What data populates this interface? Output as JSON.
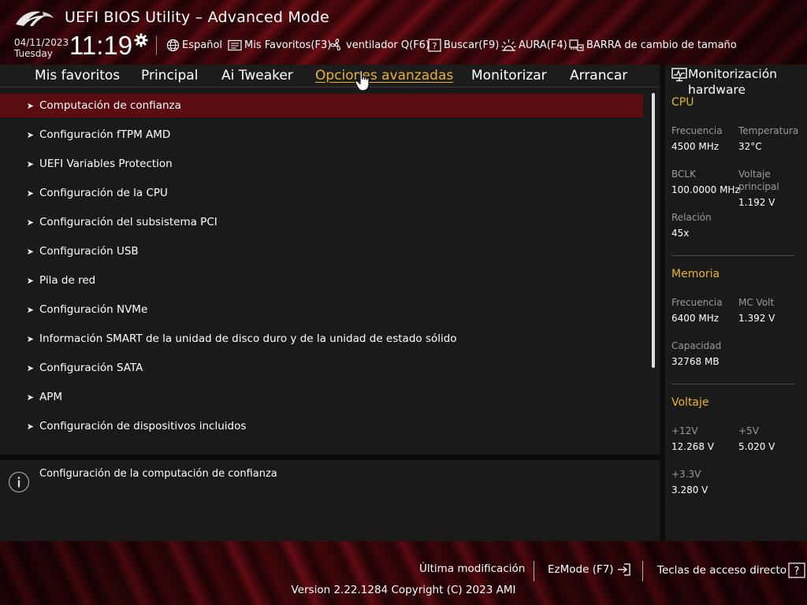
{
  "header": {
    "title": "UEFI BIOS Utility – Advanced Mode",
    "date": "04/11/2023",
    "day": "Tuesday",
    "time": "11:19",
    "toolbar": {
      "language": "Español",
      "favorites": "Mis Favoritos(F3)",
      "qfan": "ventilador Q(F6)",
      "search": "Buscar(F9)",
      "aura": "AURA(F4)",
      "resize_bar": "BARRA de cambio de tamaño"
    }
  },
  "nav": {
    "tabs": [
      {
        "label": "Mis favoritos"
      },
      {
        "label": "Principal"
      },
      {
        "label": "Ai Tweaker"
      },
      {
        "label": "Opciones avanzadas",
        "active": true
      },
      {
        "label": "Monitorizar"
      },
      {
        "label": "Arrancar"
      }
    ]
  },
  "menu": {
    "items": [
      {
        "label": "Computación de confianza",
        "selected": true
      },
      {
        "label": "Configuración fTPM AMD"
      },
      {
        "label": "UEFI Variables Protection"
      },
      {
        "label": "Configuración de la CPU"
      },
      {
        "label": "Configuración del subsistema PCI"
      },
      {
        "label": "Configuración USB"
      },
      {
        "label": "Pila de red"
      },
      {
        "label": "Configuración NVMe"
      },
      {
        "label": "Información SMART de la unidad de disco duro y de la unidad de estado sólido"
      },
      {
        "label": "Configuración SATA"
      },
      {
        "label": "APM"
      },
      {
        "label": "Configuración de dispositivos incluidos"
      }
    ],
    "arrow_glyph": "➤"
  },
  "help": {
    "text": "Configuración de la computación de confianza"
  },
  "hw_monitor": {
    "title": "Monitorización hardware",
    "cpu": {
      "heading": "CPU",
      "freq_label": "Frecuencia",
      "freq_value": "4500 MHz",
      "temp_label": "Temperatura",
      "temp_value": "32°C",
      "bclk_label": "BCLK",
      "bclk_value": "100.0000 MHz",
      "vcore_label_1": "Voltaje",
      "vcore_label_2": "principal",
      "vcore_value": "1.192 V",
      "ratio_label": "Relación",
      "ratio_value": "45x"
    },
    "memory": {
      "heading": "Memoria",
      "freq_label": "Frecuencia",
      "freq_value": "6400 MHz",
      "mcvolt_label": "MC Volt",
      "mcvolt_value": "1.392 V",
      "capacity_label": "Capacidad",
      "capacity_value": "32768 MB"
    },
    "voltage": {
      "heading": "Voltaje",
      "v12_label": "+12V",
      "v12_value": "12.268 V",
      "v5_label": "+5V",
      "v5_value": "5.020 V",
      "v33_label": "+3.3V",
      "v33_value": "3.280 V"
    }
  },
  "footer": {
    "last_modified": "Última modificación",
    "ezmode": "EzMode (F7)",
    "hotkeys": "Teclas de acceso directo",
    "version": "Version 2.22.1284 Copyright (C) 2023 AMI"
  },
  "colors": {
    "accent": "#e8b32c",
    "selected_row": "#5a0c11",
    "panel_bg": "#1a1a1a"
  },
  "icons": [
    "rog-logo",
    "gear-icon",
    "globe-icon",
    "favorites-icon",
    "fan-icon",
    "search-help-icon",
    "aura-icon",
    "resize-bar-icon",
    "hw-monitor-icon",
    "info-icon",
    "exit-icon",
    "hotkeys-icon",
    "hand-cursor-icon"
  ]
}
